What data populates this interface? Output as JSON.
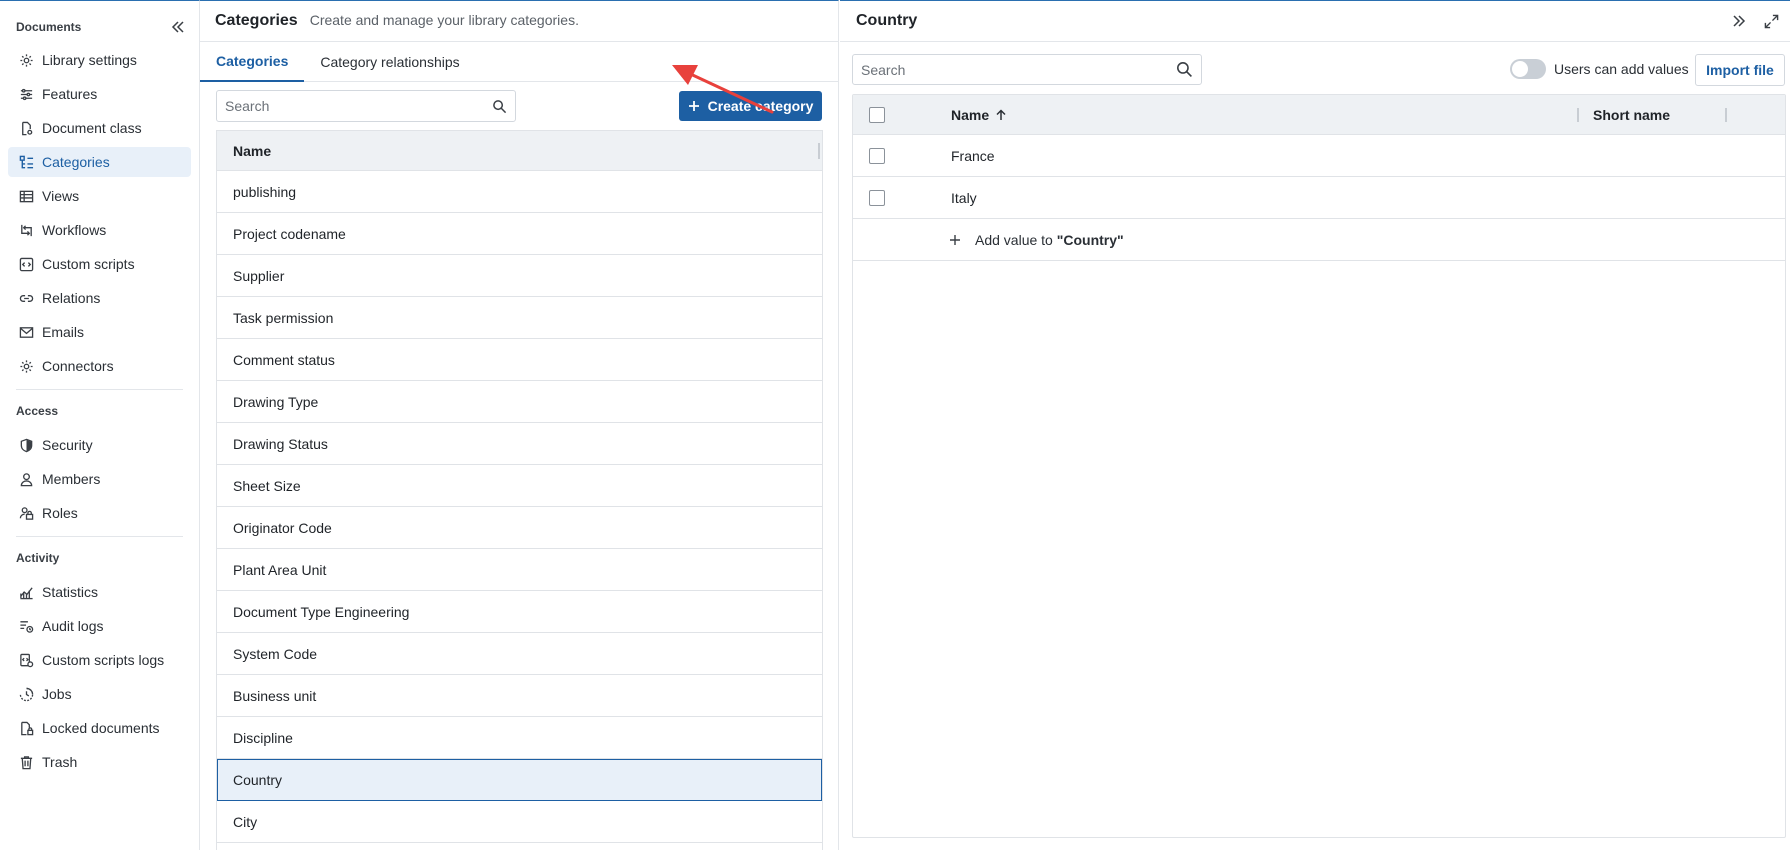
{
  "sidebar": {
    "documents_title": "Documents",
    "documents_items": [
      {
        "label": "Library settings",
        "icon": "gear-icon"
      },
      {
        "label": "Features",
        "icon": "sliders-icon"
      },
      {
        "label": "Document class",
        "icon": "document-gear-icon"
      },
      {
        "label": "Categories",
        "icon": "categories-icon",
        "active": true
      },
      {
        "label": "Views",
        "icon": "table-icon"
      },
      {
        "label": "Workflows",
        "icon": "workflow-icon"
      },
      {
        "label": "Custom scripts",
        "icon": "code-icon"
      },
      {
        "label": "Relations",
        "icon": "link-icon"
      },
      {
        "label": "Emails",
        "icon": "mail-icon"
      },
      {
        "label": "Connectors",
        "icon": "gear-icon"
      }
    ],
    "access_title": "Access",
    "access_items": [
      {
        "label": "Security",
        "icon": "shield-icon"
      },
      {
        "label": "Members",
        "icon": "person-icon"
      },
      {
        "label": "Roles",
        "icon": "roles-icon"
      }
    ],
    "activity_title": "Activity",
    "activity_items": [
      {
        "label": "Statistics",
        "icon": "chart-icon"
      },
      {
        "label": "Audit logs",
        "icon": "audit-icon"
      },
      {
        "label": "Custom scripts logs",
        "icon": "script-log-icon"
      },
      {
        "label": "Jobs",
        "icon": "jobs-icon"
      },
      {
        "label": "Locked documents",
        "icon": "locked-document-icon"
      },
      {
        "label": "Trash",
        "icon": "trash-icon"
      }
    ]
  },
  "categories_page": {
    "title": "Categories",
    "subtitle": "Create and manage your library categories.",
    "tabs": [
      {
        "label": "Categories",
        "active": true
      },
      {
        "label": "Category relationships",
        "active": false
      }
    ],
    "search_placeholder": "Search",
    "create_button": "Create category",
    "table_header": "Name",
    "rows": [
      "publishing",
      "Project codename",
      "Supplier",
      "Task permission",
      "Comment status",
      "Drawing Type",
      "Drawing Status",
      "Sheet Size",
      "Originator Code",
      "Plant Area Unit",
      "Document Type Engineering",
      "System Code",
      "Business unit",
      "Discipline",
      "Country",
      "City"
    ],
    "selected_row": "Country"
  },
  "detail": {
    "title": "Country",
    "search_placeholder": "Search",
    "toggle_label": "Users can add values",
    "toggle_on": false,
    "import_button": "Import file",
    "columns": {
      "name": "Name",
      "short_name": "Short name"
    },
    "values": [
      {
        "name": "France",
        "short_name": ""
      },
      {
        "name": "Italy",
        "short_name": ""
      }
    ],
    "add_value_prefix": "Add value to",
    "add_value_target": "\"Country\""
  },
  "colors": {
    "accent": "#1d5fa3",
    "selected_bg": "#e8f0f9",
    "annotation_arrow": "#e8413c"
  }
}
